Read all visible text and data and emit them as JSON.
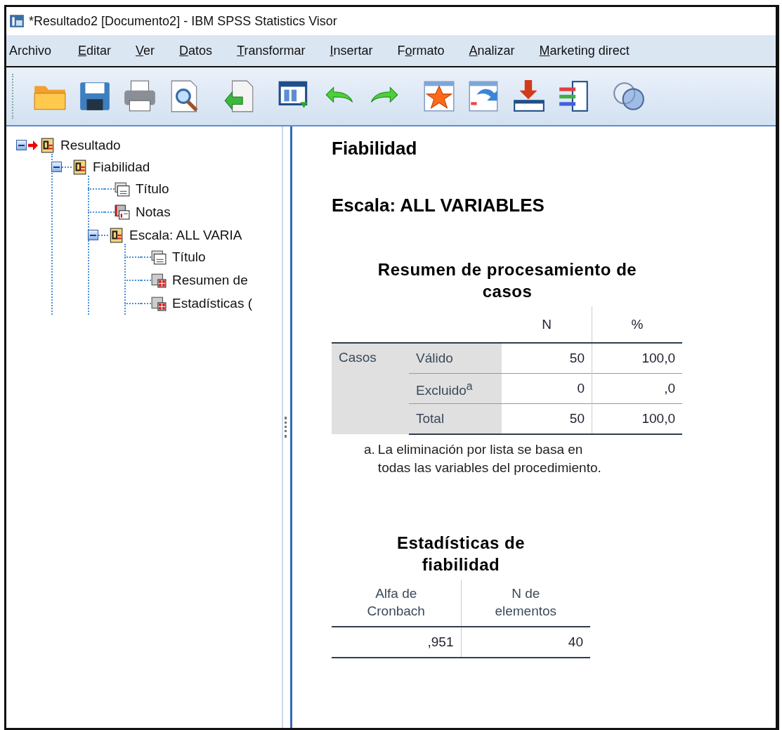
{
  "window": {
    "title": "*Resultado2 [Documento2] - IBM SPSS Statistics Visor"
  },
  "menu": [
    {
      "parts": [
        {
          "text": "Archivo",
          "underlined": false
        }
      ]
    },
    {
      "parts": [
        {
          "text": "E",
          "underlined": true
        },
        {
          "text": "ditar",
          "underlined": false
        }
      ]
    },
    {
      "parts": [
        {
          "text": "V",
          "underlined": true
        },
        {
          "text": "er",
          "underlined": false
        }
      ]
    },
    {
      "parts": [
        {
          "text": "D",
          "underlined": true
        },
        {
          "text": "atos",
          "underlined": false
        }
      ]
    },
    {
      "parts": [
        {
          "text": "T",
          "underlined": true
        },
        {
          "text": "ransformar",
          "underlined": false
        }
      ]
    },
    {
      "parts": [
        {
          "text": "I",
          "underlined": true
        },
        {
          "text": "nsertar",
          "underlined": false
        }
      ]
    },
    {
      "parts": [
        {
          "text": "F",
          "underlined": false
        },
        {
          "text": "o",
          "underlined": true
        },
        {
          "text": "rmato",
          "underlined": false
        }
      ]
    },
    {
      "parts": [
        {
          "text": "A",
          "underlined": true
        },
        {
          "text": "nalizar",
          "underlined": false
        }
      ]
    },
    {
      "parts": [
        {
          "text": "M",
          "underlined": true
        },
        {
          "text": "arketing direct",
          "underlined": false
        }
      ]
    }
  ],
  "toolbar": [
    {
      "kind": "open"
    },
    {
      "kind": "save"
    },
    {
      "kind": "print"
    },
    {
      "kind": "preview"
    },
    {
      "kind": "export"
    },
    {
      "kind": "dialog"
    },
    {
      "kind": "undo"
    },
    {
      "kind": "redo"
    },
    {
      "kind": "star"
    },
    {
      "kind": "goto"
    },
    {
      "kind": "insert"
    },
    {
      "kind": "variables"
    },
    {
      "kind": "circles"
    }
  ],
  "outline": [
    {
      "label": "Resultado",
      "kind": "book",
      "expanded": true,
      "current": true,
      "children": [
        {
          "label": "Fiabilidad",
          "kind": "book",
          "expanded": true,
          "current": false,
          "children": [
            {
              "label": "Título",
              "kind": "title",
              "current": false
            },
            {
              "label": "Notas",
              "kind": "notes",
              "current": false
            },
            {
              "label": "Escala: ALL VARIA",
              "kind": "book",
              "expanded": true,
              "current": false,
              "children": [
                {
                  "label": "Título",
                  "kind": "title",
                  "current": false
                },
                {
                  "label": "Resumen de",
                  "kind": "table",
                  "current": false
                },
                {
                  "label": "Estadísticas (",
                  "kind": "table",
                  "current": false
                }
              ]
            }
          ]
        }
      ]
    }
  ],
  "output": {
    "heading": "Fiabilidad",
    "subheading": "Escala: ALL VARIABLES",
    "summary_table": {
      "title": "Resumen de procesamiento de casos",
      "columns": [
        "N",
        "%"
      ],
      "group": "Casos",
      "rows": [
        {
          "label": "Válido",
          "n": "50",
          "pct": "100,0"
        },
        {
          "label": "Excluido$^{a}$",
          "n": "0",
          "pct": ",0"
        },
        {
          "label": "Total",
          "n": "50",
          "pct": "100,0"
        }
      ],
      "footnote_mark": "a.",
      "footnote": "La eliminación por lista se basa en todas las variables del procedimiento."
    },
    "reliability_table": {
      "title": "Estadísticas de fiabilidad",
      "columns": [
        "Alfa de Cronbach",
        "N de elementos"
      ],
      "values": [
        ",951",
        "40"
      ]
    }
  }
}
